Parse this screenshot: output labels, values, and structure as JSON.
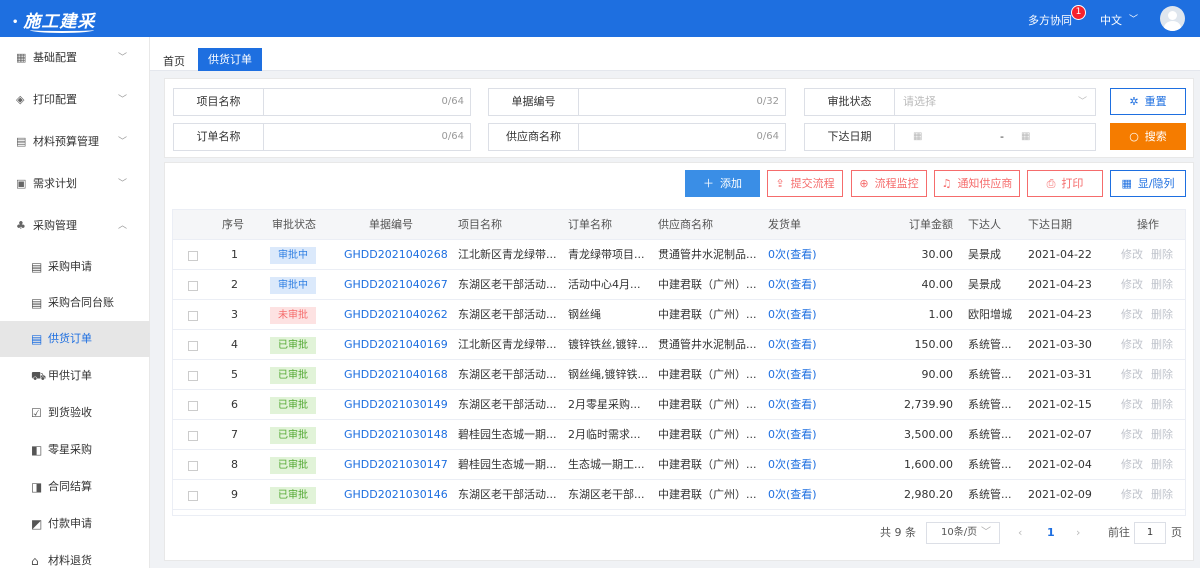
{
  "header": {
    "logo": "施工建采",
    "collab_label": "多方协同",
    "collab_badge": "1",
    "lang_label": "中文"
  },
  "sidebar": {
    "groups": [
      {
        "label": "基础配置",
        "icon": "grid-icon"
      },
      {
        "label": "打印配置",
        "icon": "layers-icon"
      },
      {
        "label": "材料预算管理",
        "icon": "database-icon"
      },
      {
        "label": "需求计划",
        "icon": "calendar-icon"
      },
      {
        "label": "采购管理",
        "icon": "org-icon"
      }
    ],
    "sub_items": [
      {
        "label": "采购申请"
      },
      {
        "label": "采购合同台账"
      },
      {
        "label": "供货订单"
      },
      {
        "label": "甲供订单"
      },
      {
        "label": "到货验收"
      },
      {
        "label": "零星采购"
      },
      {
        "label": "合同结算"
      },
      {
        "label": "付款申请"
      },
      {
        "label": "材料退货"
      }
    ]
  },
  "tabs": {
    "home": "首页",
    "active": "供货订单"
  },
  "filters": {
    "project_name": {
      "label": "项目名称",
      "count": "0/64"
    },
    "doc_no": {
      "label": "单据编号",
      "count": "0/32"
    },
    "approval": {
      "label": "审批状态",
      "placeholder": "请选择"
    },
    "order_name": {
      "label": "订单名称",
      "count": "0/64"
    },
    "supplier": {
      "label": "供应商名称",
      "count": "0/64"
    },
    "issue_date": {
      "label": "下达日期",
      "separator": "-"
    },
    "reset_label": "重置",
    "search_label": "搜索"
  },
  "toolbar": {
    "add": "添加",
    "submit_flow": "提交流程",
    "flow_monitor": "流程监控",
    "notify_supplier": "通知供应商",
    "print": "打印",
    "show_hide": "显/隐列"
  },
  "table": {
    "headers": [
      "序号",
      "审批状态",
      "单据编号",
      "项目名称",
      "订单名称",
      "供应商名称",
      "发货单",
      "订单金额",
      "下达人",
      "下达日期",
      "操作"
    ],
    "op_edit": "修改",
    "op_delete": "删除",
    "rows": [
      {
        "no": "1",
        "status": "审批中",
        "doc": "GHDD2021040268",
        "project": "江北新区青龙绿带...",
        "order": "青龙绿带项目...",
        "supplier": "贯通管井水泥制品...",
        "ship": "0次(查看)",
        "amount": "30.00",
        "by": "吴景成",
        "date": "2021-04-22"
      },
      {
        "no": "2",
        "status": "审批中",
        "doc": "GHDD2021040267",
        "project": "东湖区老干部活动...",
        "order": "活动中心4月...",
        "supplier": "中建君联（广州）...",
        "ship": "0次(查看)",
        "amount": "40.00",
        "by": "吴景成",
        "date": "2021-04-23"
      },
      {
        "no": "3",
        "status": "未审批",
        "doc": "GHDD2021040262",
        "project": "东湖区老干部活动...",
        "order": "钢丝绳",
        "supplier": "中建君联（广州）...",
        "ship": "0次(查看)",
        "amount": "1.00",
        "by": "欧阳增城",
        "date": "2021-04-23"
      },
      {
        "no": "4",
        "status": "已审批",
        "doc": "GHDD2021040169",
        "project": "江北新区青龙绿带...",
        "order": "镀锌铁丝,镀锌...",
        "supplier": "贯通管井水泥制品...",
        "ship": "0次(查看)",
        "amount": "150.00",
        "by": "系统管...",
        "date": "2021-03-30"
      },
      {
        "no": "5",
        "status": "已审批",
        "doc": "GHDD2021040168",
        "project": "东湖区老干部活动...",
        "order": "钢丝绳,镀锌铁...",
        "supplier": "中建君联（广州）...",
        "ship": "0次(查看)",
        "amount": "90.00",
        "by": "系统管...",
        "date": "2021-03-31"
      },
      {
        "no": "6",
        "status": "已审批",
        "doc": "GHDD2021030149",
        "project": "东湖区老干部活动...",
        "order": "2月零星采购...",
        "supplier": "中建君联（广州）...",
        "ship": "0次(查看)",
        "amount": "2,739.90",
        "by": "系统管...",
        "date": "2021-02-15"
      },
      {
        "no": "7",
        "status": "已审批",
        "doc": "GHDD2021030148",
        "project": "碧桂园生态城一期...",
        "order": "2月临时需求...",
        "supplier": "中建君联（广州）...",
        "ship": "0次(查看)",
        "amount": "3,500.00",
        "by": "系统管...",
        "date": "2021-02-07"
      },
      {
        "no": "8",
        "status": "已审批",
        "doc": "GHDD2021030147",
        "project": "碧桂园生态城一期...",
        "order": "生态城一期工...",
        "supplier": "中建君联（广州）...",
        "ship": "0次(查看)",
        "amount": "1,600.00",
        "by": "系统管...",
        "date": "2021-02-04"
      },
      {
        "no": "9",
        "status": "已审批",
        "doc": "GHDD2021030146",
        "project": "东湖区老干部活动...",
        "order": "东湖区老干部...",
        "supplier": "中建君联（广州）...",
        "ship": "0次(查看)",
        "amount": "2,980.20",
        "by": "系统管...",
        "date": "2021-02-09"
      }
    ]
  },
  "pagination": {
    "total": "共 9 条",
    "page_size": "10条/页",
    "prev": "‹",
    "current": "1",
    "next": "›",
    "goto_label": "前往",
    "goto_value": "1",
    "page_suffix": "页"
  },
  "colors": {
    "primary": "#1e6fe0",
    "search": "#f57c00",
    "danger": "#f56c6c",
    "tag_pending_bg": "#dbe9fb",
    "tag_pending_fg": "#2f7fe3",
    "tag_rejected_bg": "#fde2e2",
    "tag_rejected_fg": "#f56c6c",
    "tag_done_bg": "#e1f3d8",
    "tag_done_fg": "#52a832"
  }
}
